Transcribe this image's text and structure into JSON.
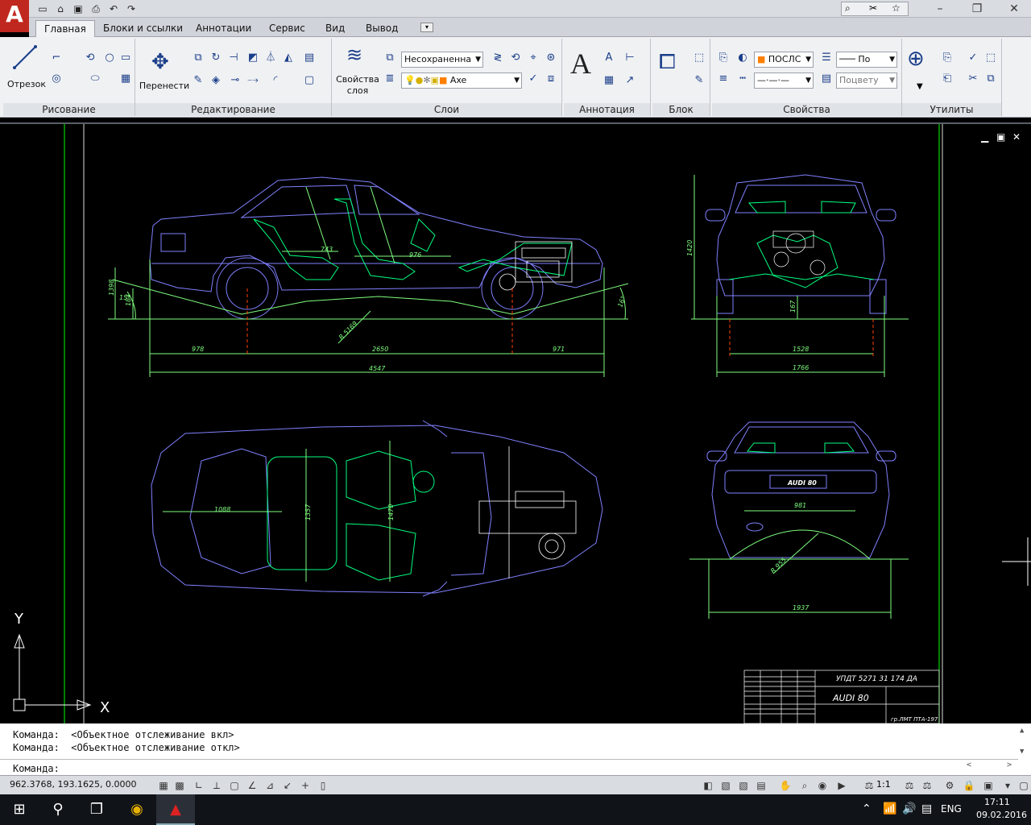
{
  "title_bar": {
    "qat_icons": [
      "new-icon",
      "open-icon",
      "save-icon",
      "print-icon",
      "undo-icon",
      "redo-icon"
    ],
    "search_icons": [
      "search-icon",
      "help-icon",
      "favorites-icon"
    ],
    "window_controls": [
      "minimize",
      "restore",
      "close"
    ]
  },
  "tabs": [
    {
      "label": "Главная",
      "active": true
    },
    {
      "label": "Блоки и ссылки"
    },
    {
      "label": "Аннотации"
    },
    {
      "label": "Сервис"
    },
    {
      "label": "Вид"
    },
    {
      "label": "Вывод"
    }
  ],
  "ribbon": {
    "draw": {
      "title": "Рисование",
      "line_label": "Отрезок"
    },
    "modify": {
      "title": "Редактирование",
      "move_label": "Перенести"
    },
    "layers": {
      "title": "Слои",
      "props_label": "Свойства слоя",
      "state_value": "Несохраненна",
      "layer_value": "Axe"
    },
    "annotation": {
      "title": "Аннотация"
    },
    "block": {
      "title": "Блок"
    },
    "properties": {
      "title": "Свойства",
      "color_value": "ПОСЛС",
      "linetype_value": "По",
      "transparency_value": "Поцвету"
    },
    "utilities": {
      "title": "Утилиты"
    }
  },
  "drawing": {
    "dims": {
      "side_height": "1398",
      "side_ground": "184",
      "angle_left": "15°",
      "angle_right": "16°",
      "seat_1": "743",
      "seat_2": "976",
      "front_overhang": "978",
      "wheelbase": "2650",
      "rear_overhang": "971",
      "total_length": "4547",
      "radius": "R 5169",
      "front_height": "1420",
      "front_clear": "167",
      "front_track": "1528",
      "front_width": "1766",
      "top_len": "1088",
      "top_w1": "1357",
      "top_w2": "1470",
      "rear_plate_text": "AUDI 80",
      "rear_width": "981",
      "rear_radius": "R 955",
      "rear_total": "1937"
    },
    "title_block": {
      "code": "УПДТ 5271 31 174 ДА",
      "name": "AUDI 80",
      "group": "гр.ЛМТ ПТА-197"
    },
    "ucs": {
      "y": "Y",
      "x": "X"
    }
  },
  "command_line": {
    "history": [
      "Команда:  <Объектное отслеживание вкл>",
      "Команда:  <Объектное отслеживание откл>"
    ],
    "prompt": "Команда:"
  },
  "status_bar": {
    "coords": "962.3768, 193.1625, 0.0000",
    "scale": "1:1"
  },
  "taskbar": {
    "lang": "ENG",
    "time": "17:11",
    "date": "09.02.2016"
  },
  "colors": {
    "car_outline": "#8080ff",
    "interior": "#00ff7f",
    "dimensions": "#7fff7f",
    "frame": "#00ff00",
    "axis": "#ff4000",
    "ucs": "#ffffff"
  }
}
